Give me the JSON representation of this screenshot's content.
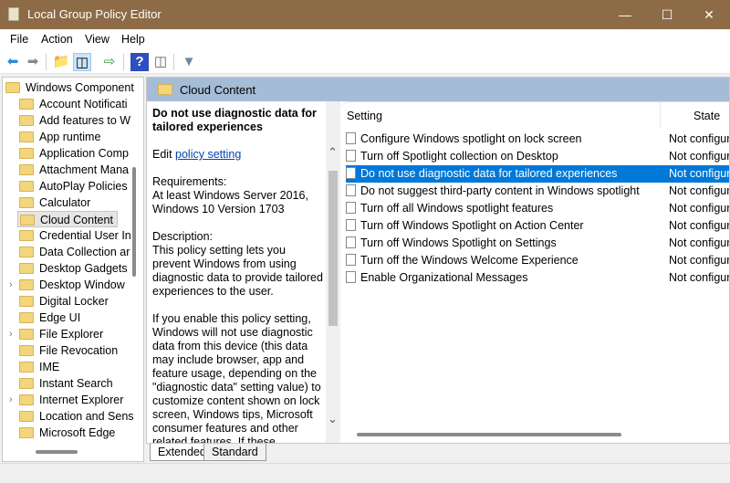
{
  "window": {
    "title": "Local Group Policy Editor"
  },
  "menu": [
    "File",
    "Action",
    "View",
    "Help"
  ],
  "tree": {
    "root": "Windows Component",
    "items": [
      {
        "label": "Account Notificati",
        "expandable": false
      },
      {
        "label": "Add features to W",
        "expandable": false
      },
      {
        "label": "App runtime",
        "expandable": false
      },
      {
        "label": "Application Comp",
        "expandable": false
      },
      {
        "label": "Attachment Mana",
        "expandable": false
      },
      {
        "label": "AutoPlay Policies",
        "expandable": false
      },
      {
        "label": "Calculator",
        "expandable": false
      },
      {
        "label": "Cloud Content",
        "expandable": false,
        "selected": true
      },
      {
        "label": "Credential User In",
        "expandable": false
      },
      {
        "label": "Data Collection ar",
        "expandable": false
      },
      {
        "label": "Desktop Gadgets",
        "expandable": false
      },
      {
        "label": "Desktop Window",
        "expandable": true
      },
      {
        "label": "Digital Locker",
        "expandable": false
      },
      {
        "label": "Edge UI",
        "expandable": false
      },
      {
        "label": "File Explorer",
        "expandable": true
      },
      {
        "label": "File Revocation",
        "expandable": false
      },
      {
        "label": "IME",
        "expandable": false
      },
      {
        "label": "Instant Search",
        "expandable": false
      },
      {
        "label": "Internet Explorer",
        "expandable": true
      },
      {
        "label": "Location and Sens",
        "expandable": false
      },
      {
        "label": "Microsoft Edge",
        "expandable": false
      }
    ]
  },
  "banner": "Cloud Content",
  "desc": {
    "title": "Do not use diagnostic data for tailored experiences",
    "edit": "Edit",
    "edit_link": "policy setting",
    "req_label": "Requirements:",
    "req": "At least Windows Server 2016, Windows 10 Version 1703",
    "desc_label": "Description:",
    "desc": "This policy setting lets you prevent Windows from using diagnostic data to provide tailored experiences to the user.",
    "more": "If you enable this policy setting, Windows will not use diagnostic data from this device (this data may include browser, app and feature usage, depending on the \"diagnostic data\" setting value) to customize content shown on lock screen, Windows tips, Microsoft consumer features and other related features. If these"
  },
  "list": {
    "col_setting": "Setting",
    "col_state": "State",
    "rows": [
      {
        "setting": "Configure Windows spotlight on lock screen",
        "state": "Not configured"
      },
      {
        "setting": "Turn off Spotlight collection on Desktop",
        "state": "Not configured"
      },
      {
        "setting": "Do not use diagnostic data for tailored experiences",
        "state": "Not configured",
        "selected": true
      },
      {
        "setting": "Do not suggest third-party content in Windows spotlight",
        "state": "Not configured"
      },
      {
        "setting": "Turn off all Windows spotlight features",
        "state": "Not configured"
      },
      {
        "setting": "Turn off Windows Spotlight on Action Center",
        "state": "Not configured"
      },
      {
        "setting": "Turn off Windows Spotlight on Settings",
        "state": "Not configured"
      },
      {
        "setting": "Turn off the Windows Welcome Experience",
        "state": "Not configured"
      },
      {
        "setting": "Enable Organizational Messages",
        "state": "Not configured"
      }
    ]
  },
  "tabs": [
    "Extended",
    "Standard"
  ]
}
